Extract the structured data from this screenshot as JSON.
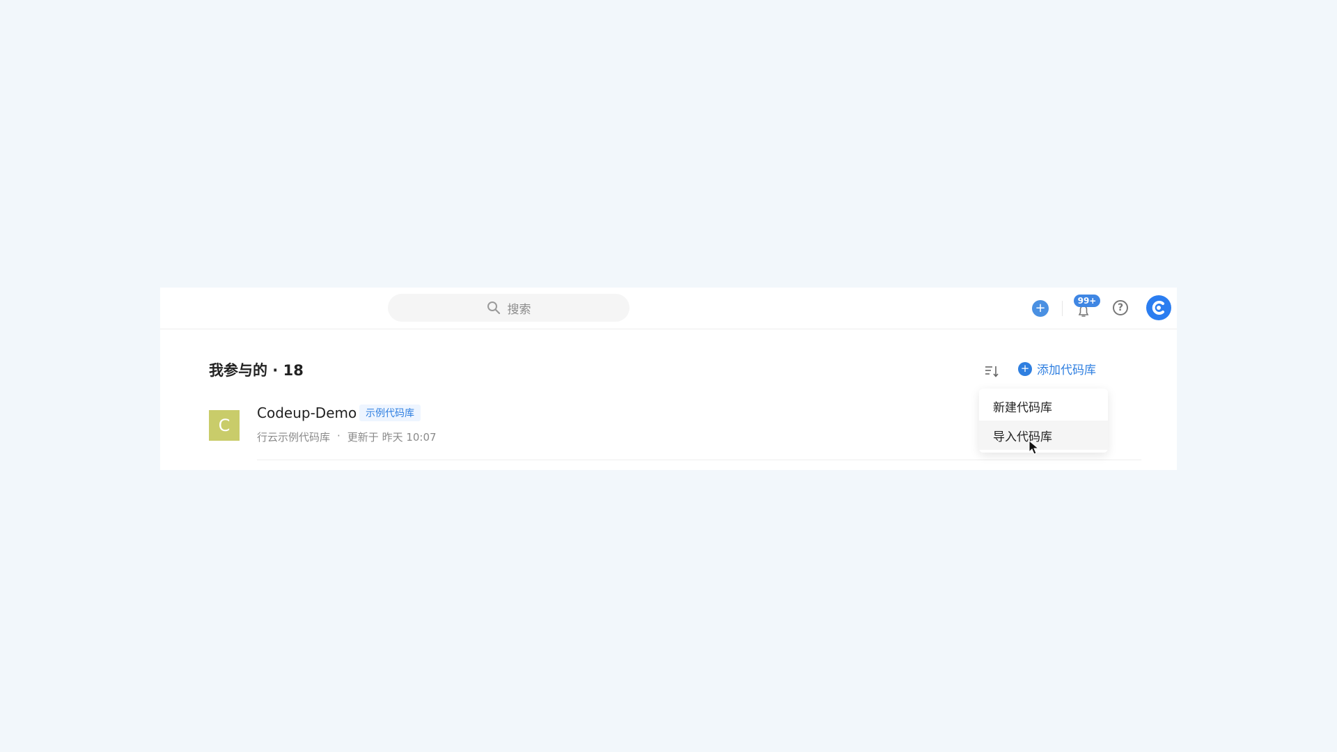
{
  "search": {
    "placeholder": "搜索"
  },
  "notifications": {
    "badge_text": "99+"
  },
  "user_avatar": {
    "letter": "C"
  },
  "main": {
    "title": "我参与的 · 18",
    "add_repo_label": "添加代码库"
  },
  "repos": [
    {
      "avatar_letter": "C",
      "avatar_color": "#c9cc6a",
      "name": "Codeup-Demo",
      "tag": "示例代码库",
      "description": "行云示例代码库",
      "separator": "·",
      "updated": "更新于 昨天 10:07"
    }
  ],
  "dropdown": {
    "items": [
      {
        "label": "新建代码库"
      },
      {
        "label": "导入代码库"
      }
    ]
  },
  "colors": {
    "accent": "#2f7fe0",
    "background": "#f2f7fb"
  },
  "icons": {
    "search": "search-icon",
    "add": "plus-icon",
    "bell": "bell-icon",
    "help": "question-icon",
    "sort": "sort-icon",
    "cursor": "mouse-cursor-icon"
  }
}
